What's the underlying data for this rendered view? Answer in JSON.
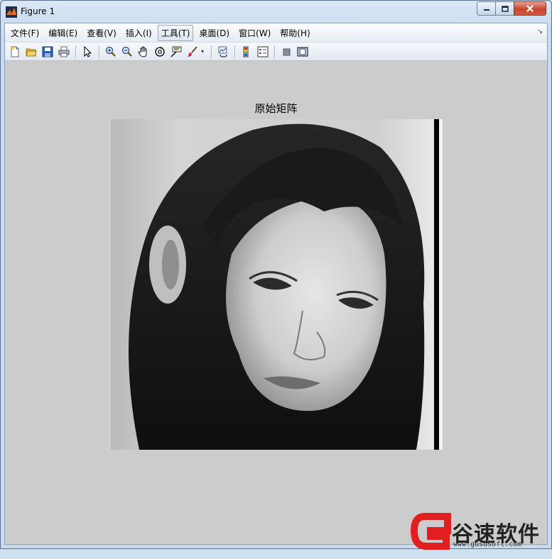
{
  "window": {
    "title": "Figure 1"
  },
  "menu": {
    "items": [
      {
        "label": "文件(F)"
      },
      {
        "label": "编辑(E)"
      },
      {
        "label": "查看(V)"
      },
      {
        "label": "插入(I)"
      },
      {
        "label": "工具(T)"
      },
      {
        "label": "桌面(D)"
      },
      {
        "label": "窗口(W)"
      },
      {
        "label": "帮助(H)"
      }
    ],
    "active_index": 4
  },
  "toolbar": {
    "icons": [
      "new-figure-icon",
      "open-file-icon",
      "save-icon",
      "print-icon",
      "edit-plot-arrow-icon",
      "zoom-in-icon",
      "zoom-out-icon",
      "pan-hand-icon",
      "rotate-3d-icon",
      "data-cursor-icon",
      "brush-icon",
      "link-plot-icon",
      "colorbar-icon",
      "legend-icon",
      "hide-plot-tools-icon",
      "show-plot-tools-icon"
    ]
  },
  "axes": {
    "title": "原始矩阵"
  },
  "watermark": {
    "brand": "谷速软件",
    "url": "www.gususoft.com",
    "accent": "#e02020"
  }
}
